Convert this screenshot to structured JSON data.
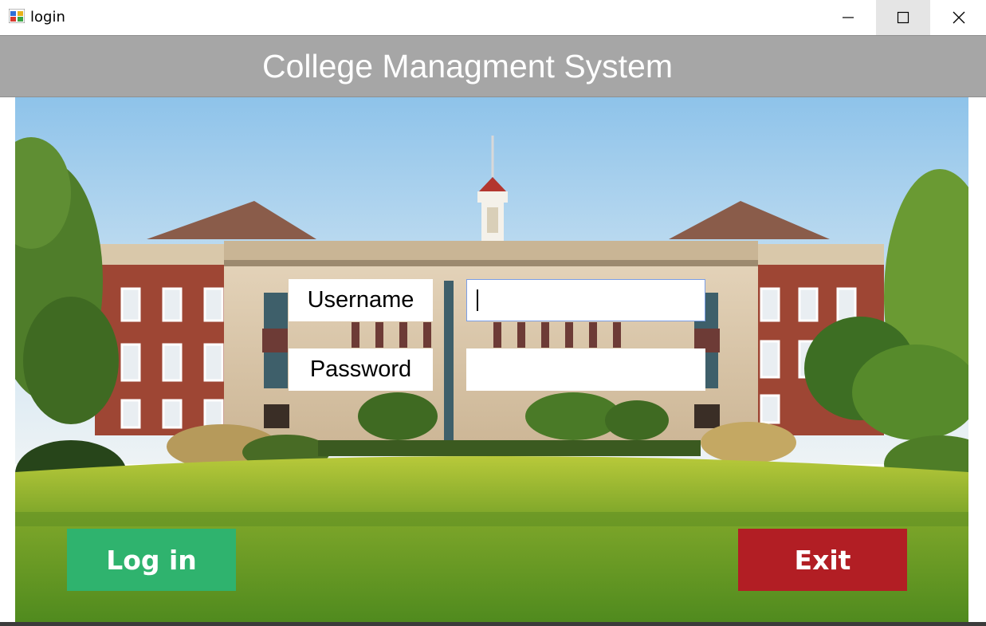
{
  "window": {
    "title": "login",
    "controls": {
      "minimize_icon": "minimize-icon",
      "maximize_icon": "maximize-icon",
      "close_icon": "close-icon"
    }
  },
  "header": {
    "title": "College Managment System",
    "background": "#a6a6a6",
    "text_color": "#ffffff"
  },
  "form": {
    "username_label": "Username",
    "password_label": "Password",
    "username_value": "",
    "password_value": ""
  },
  "actions": {
    "login_label": "Log in",
    "exit_label": "Exit",
    "login_color": "#2fb36e",
    "exit_color": "#b21e24"
  },
  "background_image": "college-campus-building-photo"
}
